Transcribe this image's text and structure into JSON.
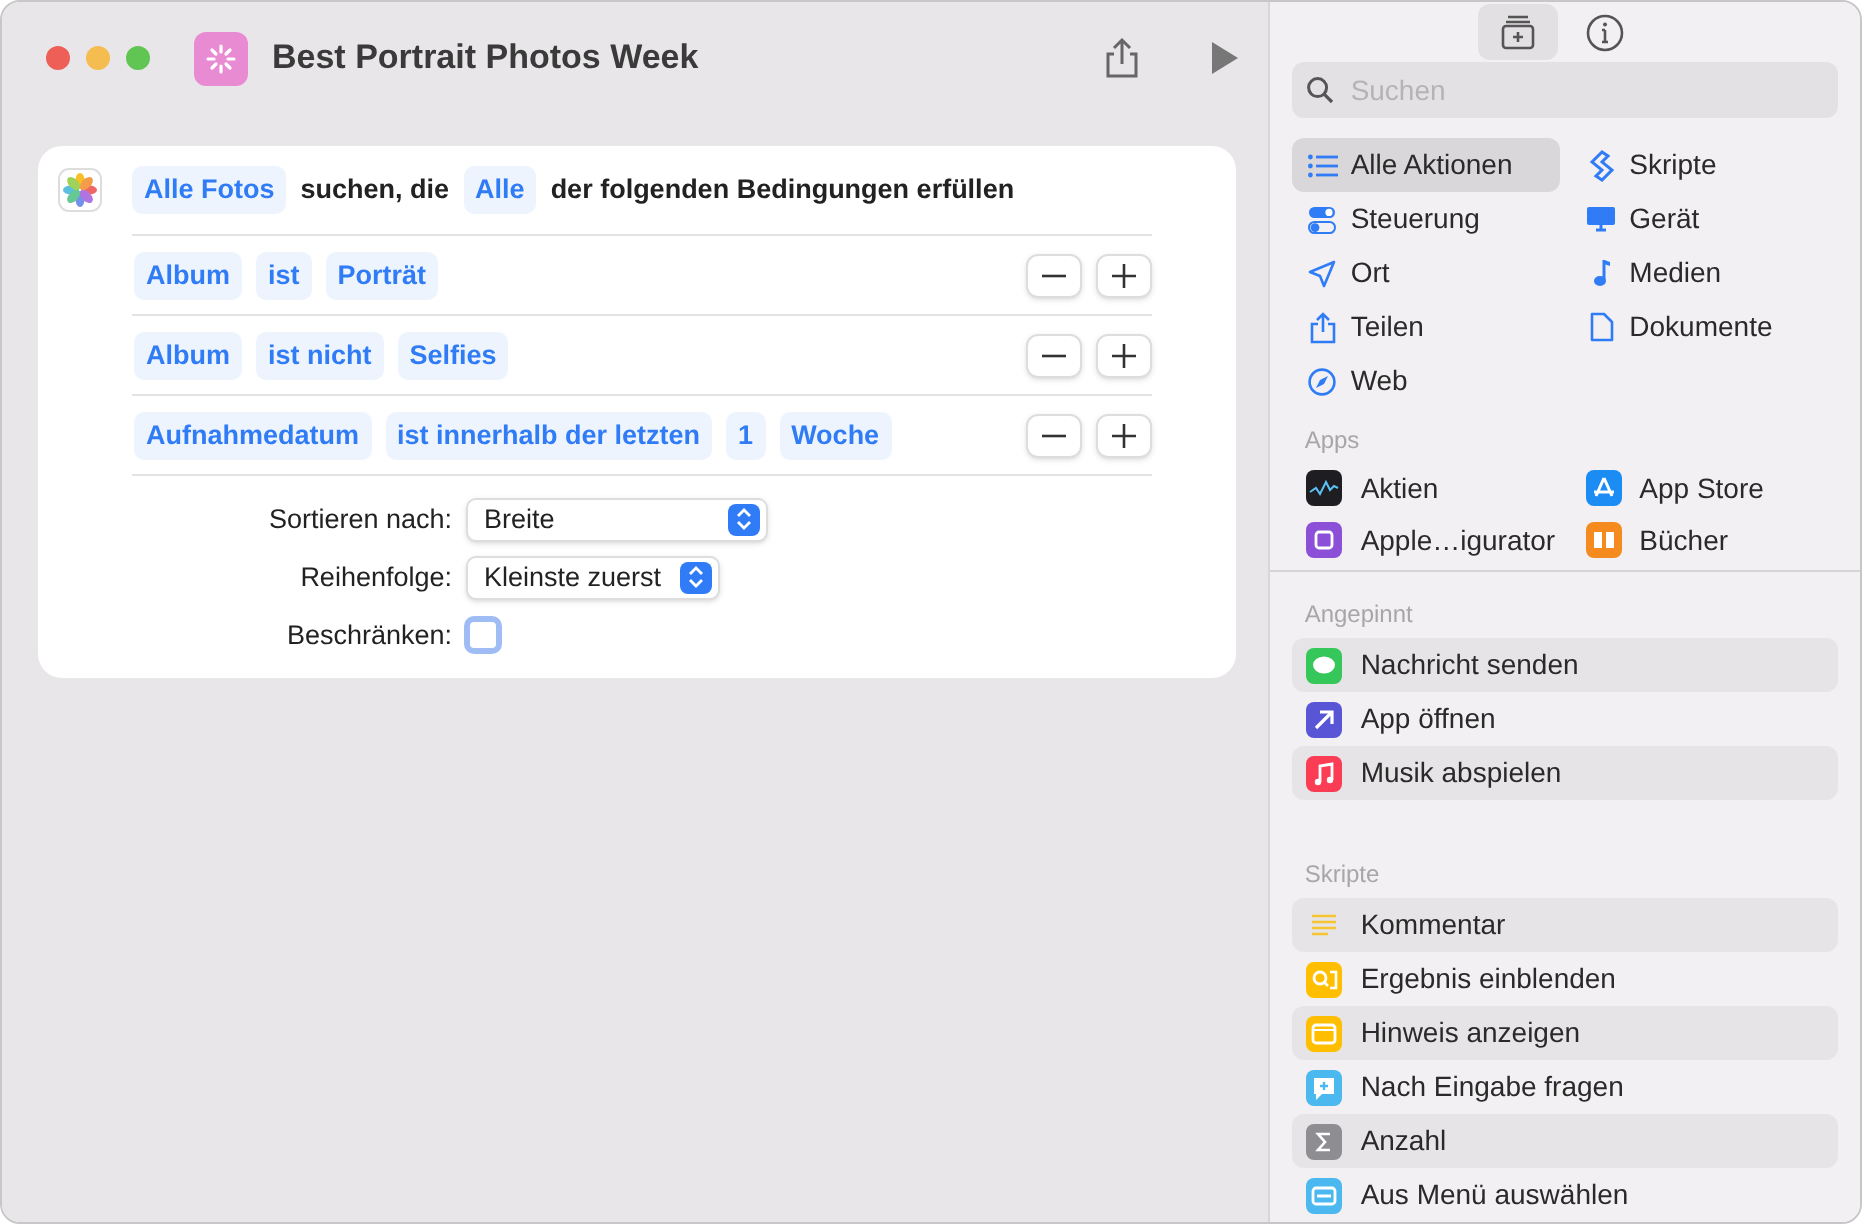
{
  "window": {
    "title": "Best Portrait Photos Week"
  },
  "action": {
    "header": [
      {
        "kind": "token",
        "text": "Alle Fotos"
      },
      {
        "kind": "text",
        "text": "suchen, die"
      },
      {
        "kind": "token",
        "text": "Alle"
      },
      {
        "kind": "text",
        "text": "der folgenden Bedingungen erfüllen"
      }
    ],
    "conditions": [
      {
        "tokens": [
          "Album",
          "ist",
          "Porträt"
        ]
      },
      {
        "tokens": [
          "Album",
          "ist nicht",
          "Selfies"
        ]
      },
      {
        "tokens": [
          "Aufnahmedatum",
          "ist innerhalb der letzten",
          "1",
          "Woche"
        ]
      }
    ],
    "options": [
      {
        "kind": "select",
        "label": "Sortieren nach:",
        "value": "Breite"
      },
      {
        "kind": "select",
        "label": "Reihenfolge:",
        "value": "Kleinste zuerst"
      },
      {
        "kind": "checkbox",
        "label": "Beschränken:",
        "checked": false
      }
    ]
  },
  "sidebar": {
    "search": {
      "placeholder": "Suchen"
    },
    "categories": [
      {
        "label": "Alle Aktionen",
        "selected": true
      },
      {
        "label": "Skripte",
        "selected": false
      },
      {
        "label": "Steuerung",
        "selected": false
      },
      {
        "label": "Gerät",
        "selected": false
      },
      {
        "label": "Ort",
        "selected": false
      },
      {
        "label": "Medien",
        "selected": false
      },
      {
        "label": "Teilen",
        "selected": false
      },
      {
        "label": "Dokumente",
        "selected": false
      },
      {
        "label": "Web",
        "selected": false
      }
    ],
    "apps_heading": "Apps",
    "apps": [
      {
        "label": "Aktien"
      },
      {
        "label": "App Store"
      },
      {
        "label": "Apple…igurator"
      },
      {
        "label": "Bücher"
      }
    ],
    "pinned_heading": "Angepinnt",
    "pinned": [
      {
        "label": "Nachricht senden"
      },
      {
        "label": "App öffnen"
      },
      {
        "label": "Musik abspielen"
      }
    ],
    "scripts_heading": "Skripte",
    "scripts": [
      {
        "label": "Kommentar"
      },
      {
        "label": "Ergebnis einblenden"
      },
      {
        "label": "Hinweis anzeigen"
      },
      {
        "label": "Nach Eingabe fragen"
      },
      {
        "label": "Anzahl"
      },
      {
        "label": "Aus Menü auswählen"
      }
    ]
  }
}
